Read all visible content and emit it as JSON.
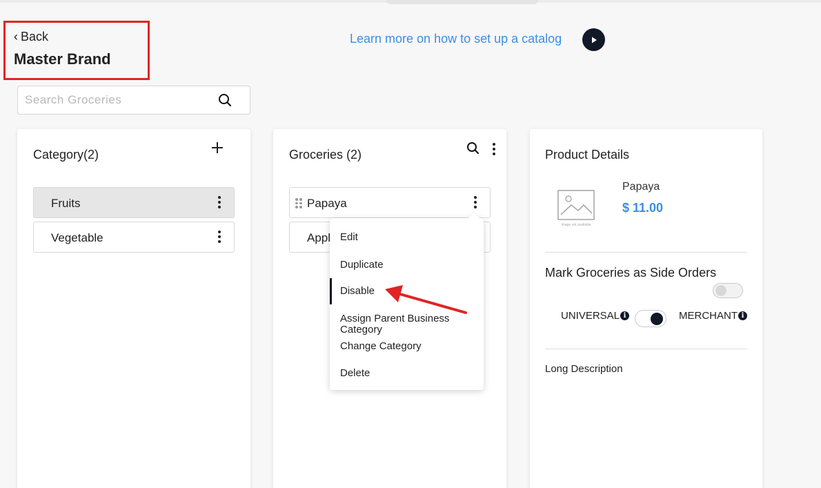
{
  "header": {
    "back_label": "Back",
    "title": "Master Brand",
    "learn_more": "Learn more on how to set up a catalog"
  },
  "search": {
    "placeholder": "Search Groceries"
  },
  "category": {
    "title": "Category(2)",
    "items": [
      {
        "label": "Fruits",
        "active": true
      },
      {
        "label": "Vegetable",
        "active": false
      }
    ]
  },
  "groceries": {
    "title": "Groceries (2)",
    "items": [
      {
        "label": "Papaya"
      },
      {
        "label": "Appl"
      }
    ],
    "menu": [
      "Edit",
      "Duplicate",
      "Disable",
      "Assign Parent Business Category",
      "Change Category",
      "Delete"
    ]
  },
  "product": {
    "title": "Product Details",
    "name": "Papaya",
    "price": "$ 11.00",
    "image_caption": "Image not available",
    "side_orders_title": "Mark Groceries as Side Orders",
    "side_orders_enabled": false,
    "universal_label": "UNIVERSAL",
    "merchant_label": "MERCHANT",
    "scope_toggle": "merchant",
    "long_description_label": "Long Description"
  },
  "colors": {
    "accent": "#3a8ee6",
    "dark": "#111827",
    "annotation": "#e02424"
  }
}
